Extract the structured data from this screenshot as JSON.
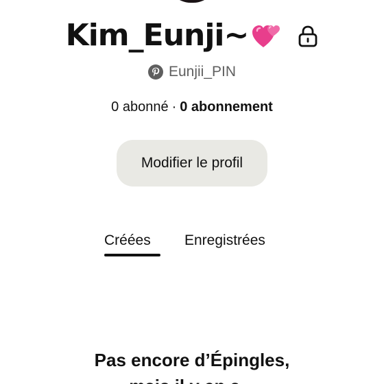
{
  "profile": {
    "name": "Kim_Eunji~",
    "name_emoji_icon": "revolving-hearts-icon",
    "privacy_icon": "lock-icon",
    "handle": "Eunjii_PIN",
    "handle_icon": "pinterest-icon"
  },
  "stats": {
    "followers": "0 abonné",
    "separator": "·",
    "following": "0 abonnement"
  },
  "actions": {
    "edit_profile_label": "Modifier le profil"
  },
  "tabs": [
    {
      "label": "Créées",
      "active": true
    },
    {
      "label": "Enregistrées",
      "active": false
    }
  ],
  "empty_state": {
    "title": "Pas encore d’Épingles,",
    "title_line2": "mais il y en a..."
  },
  "colors": {
    "background": "#ffffff",
    "text": "#111111",
    "muted": "#5f5f5f",
    "button_bg": "#e9e9e4",
    "heart_pink": "#e83e8c"
  }
}
